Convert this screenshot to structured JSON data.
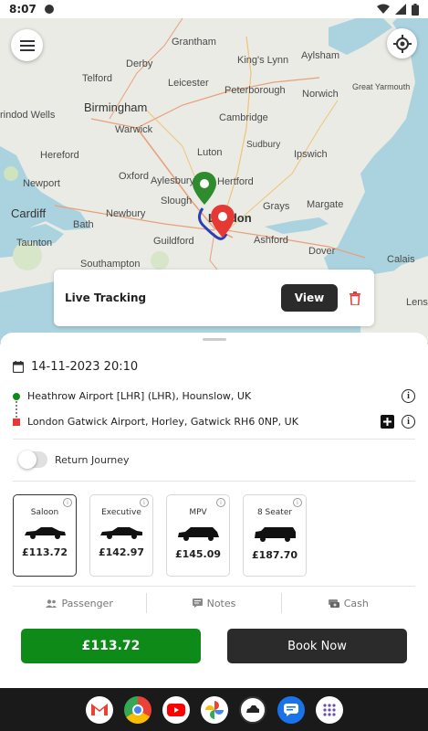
{
  "status_bar": {
    "time": "8:07"
  },
  "map": {
    "labels": {
      "grantham": "Grantham",
      "kings_lynn": "King's Lynn",
      "aylsham": "Aylsham",
      "telford": "Telford",
      "derby": "Derby",
      "leicester": "Leicester",
      "peterborough": "Peterborough",
      "norwich": "Norwich",
      "great_yarmouth": "Great Yarmouth",
      "rindod_wells": "rindod Wells",
      "birmingham": "Birmingham",
      "warwick": "Warwick",
      "cambridge": "Cambridge",
      "hereford": "Hereford",
      "luton": "Luton",
      "sudbury": "Sudbury",
      "ipswich": "Ipswich",
      "newport": "Newport",
      "oxford": "Oxford",
      "aylesbury": "Aylesbury",
      "hertford": "Hertford",
      "cardiff": "Cardiff",
      "slough": "Slough",
      "london": "London",
      "grays": "Grays",
      "margate": "Margate",
      "bath": "Bath",
      "newbury": "Newbury",
      "taunton": "Taunton",
      "guildford": "Guildford",
      "ashford": "Ashford",
      "dover": "Dover",
      "calais": "Calais",
      "southampton": "Southampton",
      "lens": "Lens"
    }
  },
  "tracking": {
    "label": "Live Tracking",
    "view_label": "View"
  },
  "booking": {
    "datetime": "14-11-2023 20:10",
    "pickup": "Heathrow Airport [LHR] (LHR), Hounslow, UK",
    "dropoff": "London Gatwick Airport, Horley, Gatwick RH6 0NP, UK",
    "return_journey_label": "Return Journey",
    "return_journey_on": false
  },
  "vehicles": [
    {
      "name": "Saloon",
      "price": "£113.72",
      "selected": true
    },
    {
      "name": "Executive",
      "price": "£142.97",
      "selected": false
    },
    {
      "name": "MPV",
      "price": "£145.09",
      "selected": false
    },
    {
      "name": "8 Seater",
      "price": "£187.70",
      "selected": false
    }
  ],
  "tabs": {
    "passenger": "Passenger",
    "notes": "Notes",
    "cash": "Cash"
  },
  "actions": {
    "price": "£113.72",
    "book": "Book Now"
  },
  "colors": {
    "green": "#0e8a18",
    "dark": "#2b2b2b",
    "red": "#e53935",
    "route": "#2b3fb5"
  }
}
